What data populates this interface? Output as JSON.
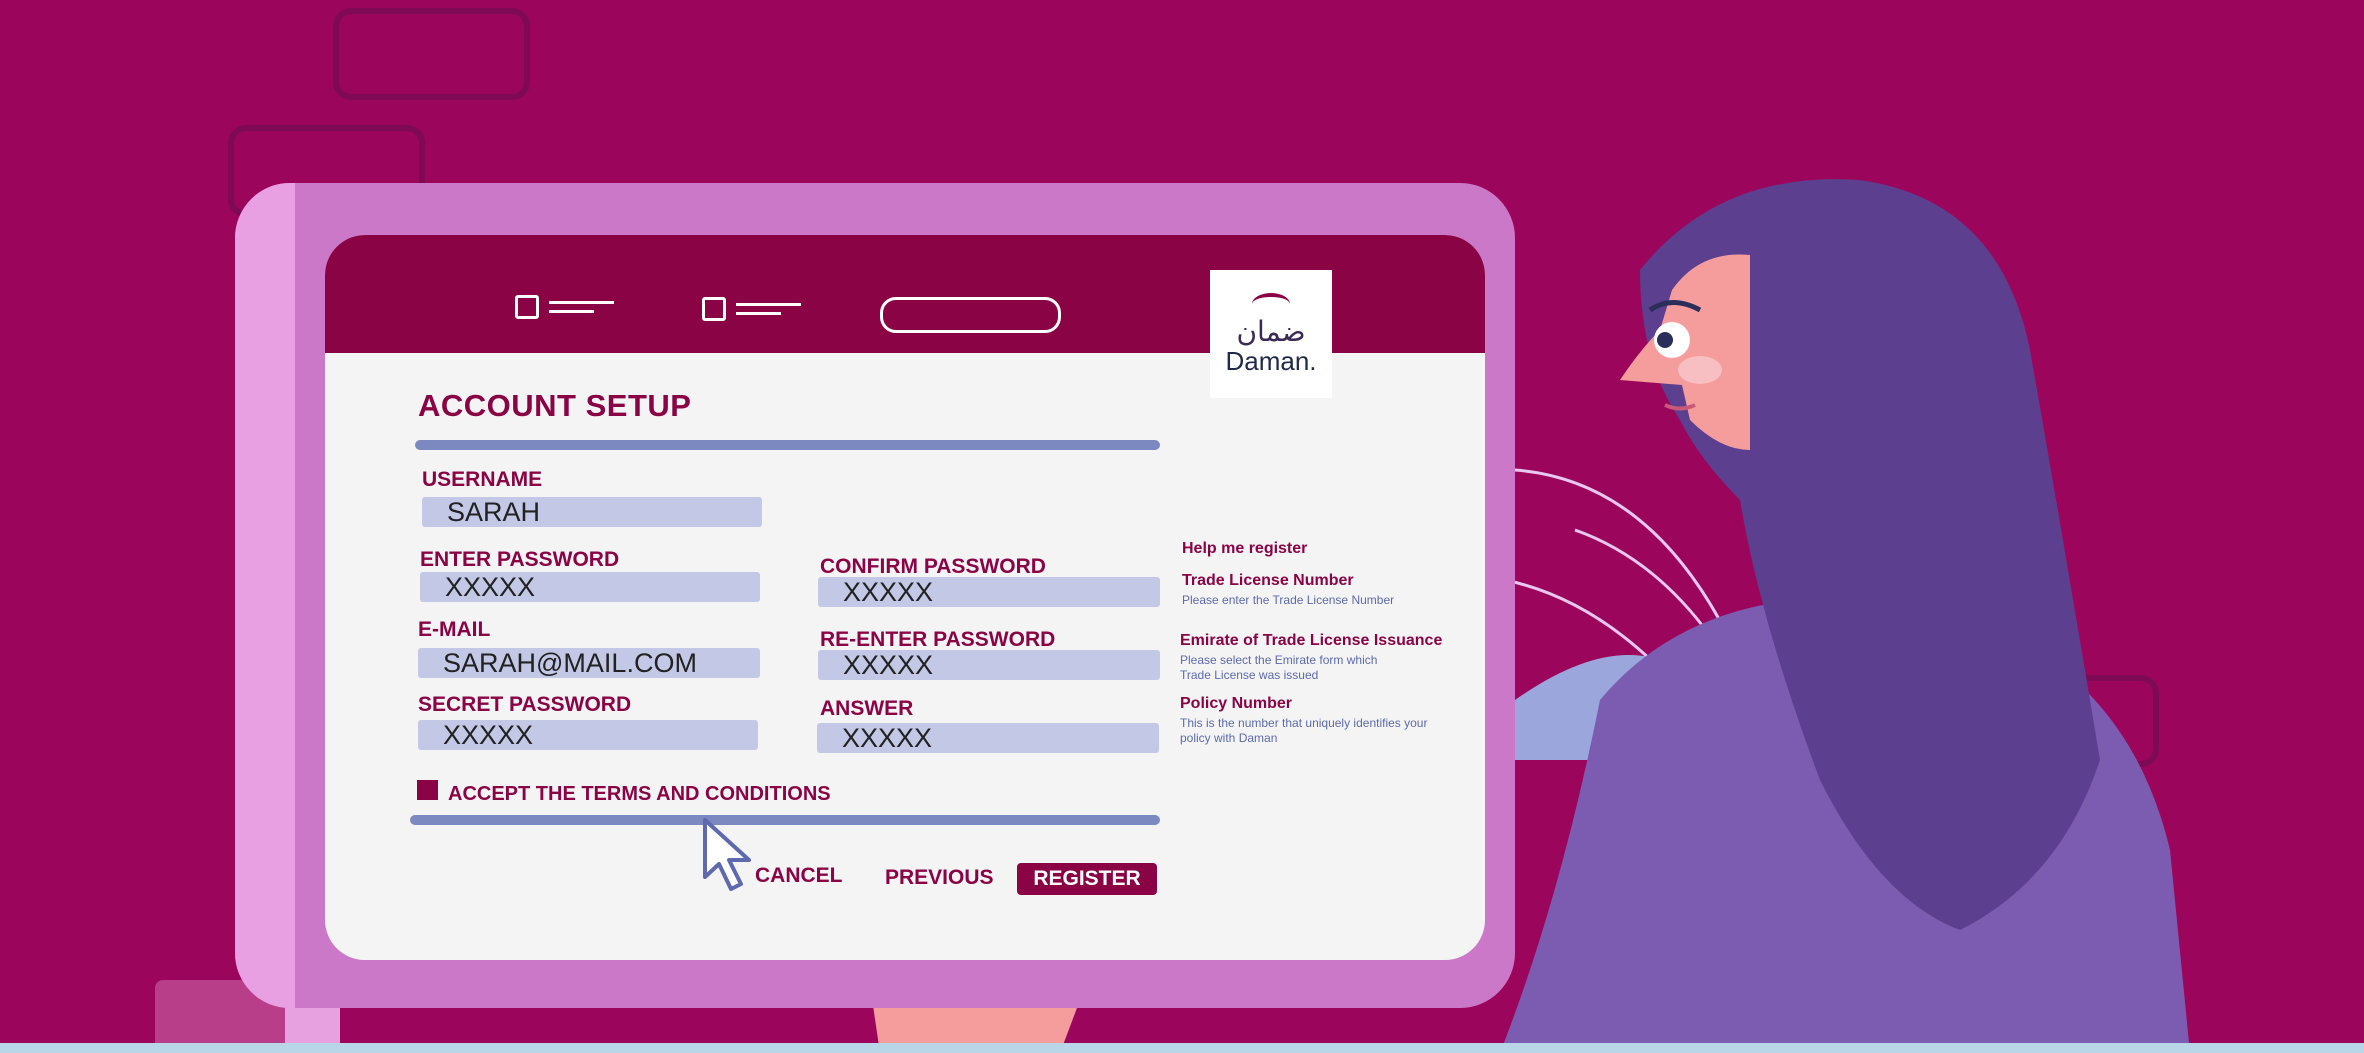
{
  "header": {
    "logo_ar": "ضمان",
    "logo_en": "Daman."
  },
  "form": {
    "title": "ACCOUNT SETUP",
    "username_label": "USERNAME",
    "username_value": "SARAH",
    "password_label": "ENTER PASSWORD",
    "password_value": "XXXXX",
    "confirm_password_label": "CONFIRM PASSWORD",
    "confirm_password_value": "XXXXX",
    "email_label": "E-MAIL",
    "email_value": "SARAH@MAIL.COM",
    "reenter_password_label": "RE-ENTER PASSWORD",
    "reenter_password_value": "XXXXX",
    "secret_password_label": "SECRET PASSWORD",
    "secret_password_value": "XXXXX",
    "answer_label": "ANSWER",
    "answer_value": "XXXXX",
    "terms_label": "ACCEPT THE TERMS AND CONDITIONS",
    "terms_checked": true
  },
  "help": {
    "heading": "Help me register",
    "items": [
      {
        "title": "Trade License Number",
        "text": "Please enter the Trade License Number"
      },
      {
        "title": "Emirate of Trade License Issuance",
        "text": "Please select the Emirate form which Trade License was issued"
      },
      {
        "title": "Policy Number",
        "text": "This is the number that uniquely identifies your policy with Daman"
      }
    ]
  },
  "actions": {
    "cancel_label": "CANCEL",
    "previous_label": "PREVIOUS",
    "register_label": "REGISTER"
  },
  "icons": [
    "nav-checkbox-icon",
    "search-bar-icon",
    "mouse-cursor-icon",
    "daman-logo"
  ],
  "colors": {
    "background": "#9c055c",
    "brand": "#8a0445",
    "monitor": "#cc78c8",
    "field": "#c3c8e6",
    "rule": "#7c89c1",
    "help_text": "#5d6aad"
  }
}
